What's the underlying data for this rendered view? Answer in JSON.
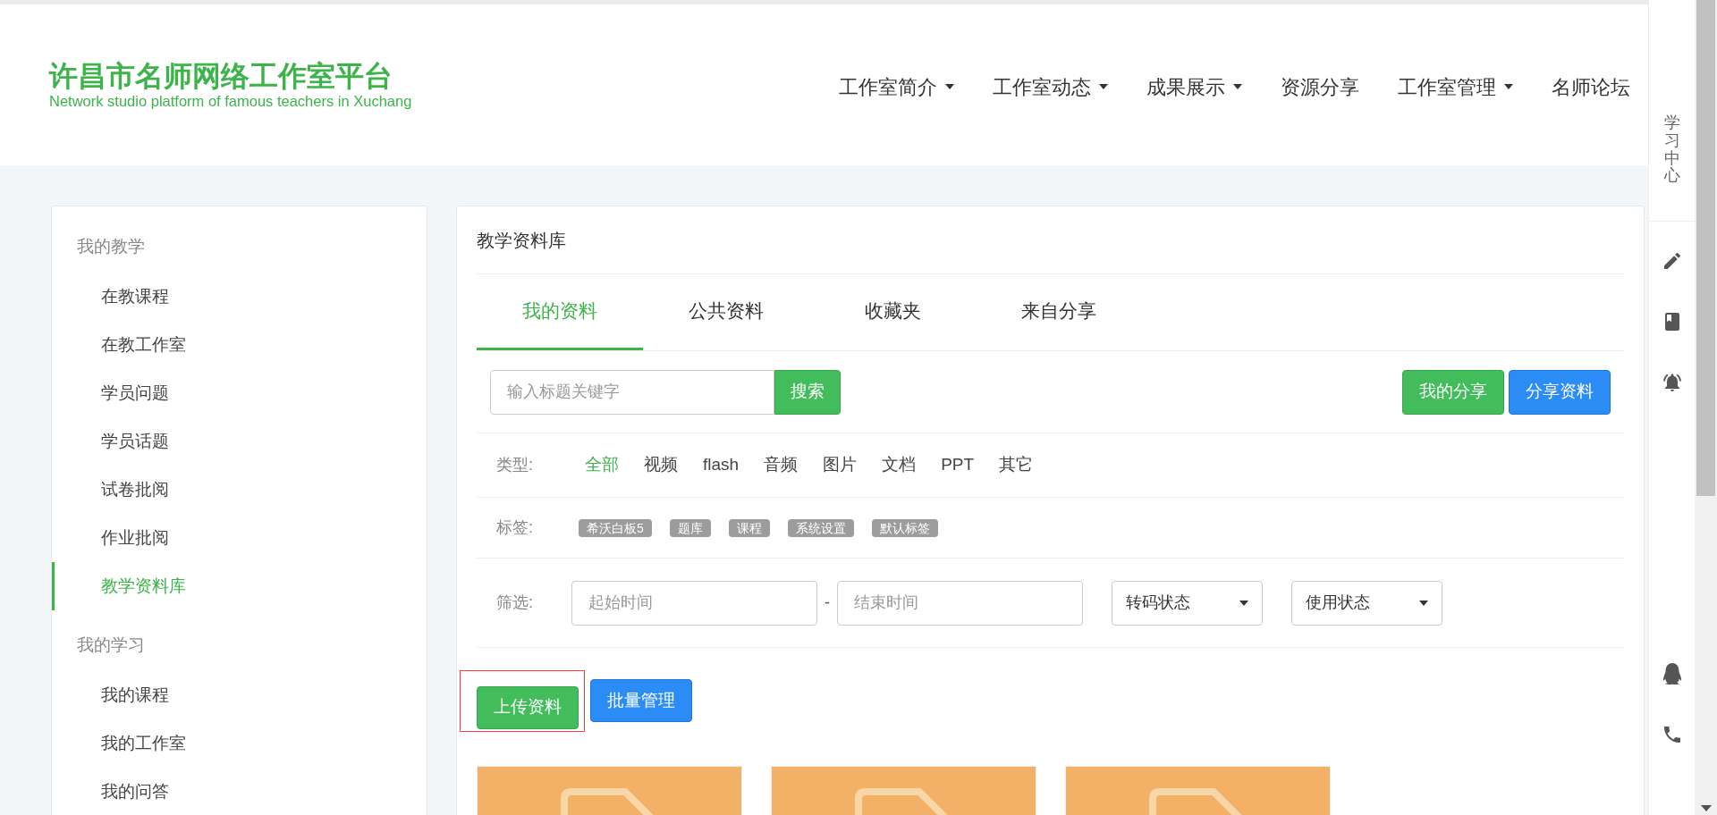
{
  "header": {
    "logo_title": "许昌市名师网络工作室平台",
    "logo_subtitle": "Network studio platform of famous teachers in Xuchang",
    "nav": [
      {
        "label": "工作室简介",
        "dropdown": true
      },
      {
        "label": "工作室动态",
        "dropdown": true
      },
      {
        "label": "成果展示",
        "dropdown": true
      },
      {
        "label": "资源分享",
        "dropdown": false
      },
      {
        "label": "工作室管理",
        "dropdown": true
      },
      {
        "label": "名师论坛",
        "dropdown": false
      }
    ]
  },
  "sidebar": {
    "groups": [
      {
        "title": "我的教学",
        "items": [
          {
            "label": "在教课程",
            "selected": false
          },
          {
            "label": "在教工作室",
            "selected": false
          },
          {
            "label": "学员问题",
            "selected": false
          },
          {
            "label": "学员话题",
            "selected": false
          },
          {
            "label": "试卷批阅",
            "selected": false
          },
          {
            "label": "作业批阅",
            "selected": false
          },
          {
            "label": "教学资料库",
            "selected": true
          }
        ]
      },
      {
        "title": "我的学习",
        "items": [
          {
            "label": "我的课程",
            "selected": false
          },
          {
            "label": "我的工作室",
            "selected": false
          },
          {
            "label": "我的问答",
            "selected": false
          }
        ]
      }
    ]
  },
  "main": {
    "title": "教学资料库",
    "tabs": [
      {
        "label": "我的资料",
        "selected": true
      },
      {
        "label": "公共资料",
        "selected": false
      },
      {
        "label": "收藏夹",
        "selected": false
      },
      {
        "label": "来自分享",
        "selected": false
      }
    ],
    "search": {
      "placeholder": "输入标题关键字",
      "button": "搜索"
    },
    "actions": [
      {
        "label": "我的分享",
        "kind": "green"
      },
      {
        "label": "分享资料",
        "kind": "blue"
      }
    ],
    "type_filter": {
      "label": "类型:",
      "options": [
        {
          "label": "全部",
          "selected": true
        },
        {
          "label": "视频",
          "selected": false
        },
        {
          "label": "flash",
          "selected": false
        },
        {
          "label": "音频",
          "selected": false
        },
        {
          "label": "图片",
          "selected": false
        },
        {
          "label": "文档",
          "selected": false
        },
        {
          "label": "PPT",
          "selected": false
        },
        {
          "label": "其它",
          "selected": false
        }
      ]
    },
    "tags": {
      "label": "标签:",
      "items": [
        "希沃白板5",
        "题库",
        "课程",
        "系统设置",
        "默认标签"
      ]
    },
    "date_filter": {
      "label": "筛选:",
      "start_placeholder": "起始时间",
      "separator": "-",
      "end_placeholder": "结束时间",
      "selects": [
        "转码状态",
        "使用状态"
      ]
    },
    "buttons": [
      {
        "label": "上传资料",
        "kind": "green",
        "highlighted": true
      },
      {
        "label": "批量管理",
        "kind": "blue",
        "highlighted": false
      }
    ],
    "files": [
      {
        "kind": "document"
      },
      {
        "kind": "document"
      },
      {
        "kind": "document"
      }
    ]
  },
  "side_tools": {
    "title": "学习中心",
    "tools": [
      {
        "kind": "pencil"
      },
      {
        "kind": "book"
      },
      {
        "kind": "bell"
      },
      {
        "kind": "qq"
      },
      {
        "kind": "phone"
      }
    ]
  }
}
